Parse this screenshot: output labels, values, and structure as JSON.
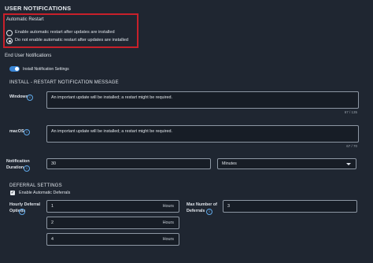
{
  "section_title": "USER NOTIFICATIONS",
  "automatic_restart": {
    "title": "Automatic Restart",
    "options": [
      {
        "label": "Enable automatic restart after updates are installed",
        "selected": false
      },
      {
        "label": "Do not enable automatic restart after updates are installed",
        "selected": true
      }
    ]
  },
  "end_user": {
    "title": "End User Notifications",
    "toggle_label": "Install Notification Settings",
    "toggle_on": true
  },
  "install_message": {
    "title": "INSTALL - RESTART NOTIFICATION MESSAGE",
    "windows_label": "Windows",
    "windows_value": "An important update will be installed; a restart might be required.",
    "windows_count": "67 / 135",
    "macos_label": "macOS",
    "macos_value": "An important update will be installed; a restart might be required.",
    "macos_count": "67 / 70",
    "duration_label": "Notification Duration",
    "duration_value": "30",
    "duration_unit": "Minutes"
  },
  "deferral": {
    "title": "DEFERRAL SETTINGS",
    "enable_label": "Enable Automatic Deferrals",
    "enabled": true,
    "hourly_label": "Hourly Deferral Options",
    "hourly_options": [
      {
        "value": "1",
        "unit": "Hours"
      },
      {
        "value": "2",
        "unit": "Hours"
      },
      {
        "value": "4",
        "unit": "Hours"
      }
    ],
    "max_label": "Max Number of Deferrals",
    "max_value": "3"
  },
  "colors": {
    "background": "#1f2631",
    "accent": "#3a86d6",
    "highlight_box": "#c8202a"
  }
}
